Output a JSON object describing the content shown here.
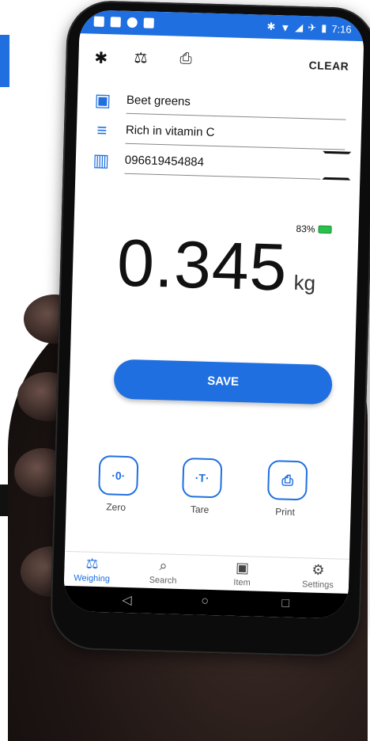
{
  "statusbar": {
    "bluetooth": "✱",
    "wifi": "▼",
    "signal": "◢",
    "airplane": "✈",
    "battery": "▮",
    "time": "7:16"
  },
  "toolbar": {
    "bluetooth_icon": "bluetooth-icon",
    "scale_icon": "scale-icon",
    "printer_off_icon": "printer-off-icon",
    "clear_label": "CLEAR"
  },
  "fields": {
    "name": "Beet greens",
    "description": "Rich in vitamin C",
    "barcode": "096619454884"
  },
  "scale": {
    "battery_percent": "83%",
    "weight": "0.345",
    "unit": "kg"
  },
  "save_label": "SAVE",
  "actions": [
    {
      "label": "Zero",
      "glyph": "·0·"
    },
    {
      "label": "Tare",
      "glyph": "·T·"
    },
    {
      "label": "Print",
      "glyph": "⎙"
    }
  ],
  "tabs": [
    {
      "label": "Weighing",
      "icon": "scale-icon",
      "active": true
    },
    {
      "label": "Search",
      "icon": "search-icon"
    },
    {
      "label": "Item",
      "icon": "item-icon"
    },
    {
      "label": "Settings",
      "icon": "gear-icon"
    }
  ],
  "nav": {
    "back": "◁",
    "home": "○",
    "recents": "□"
  },
  "colors": {
    "accent": "#1f6fe0",
    "battery_green": "#27c24c"
  }
}
